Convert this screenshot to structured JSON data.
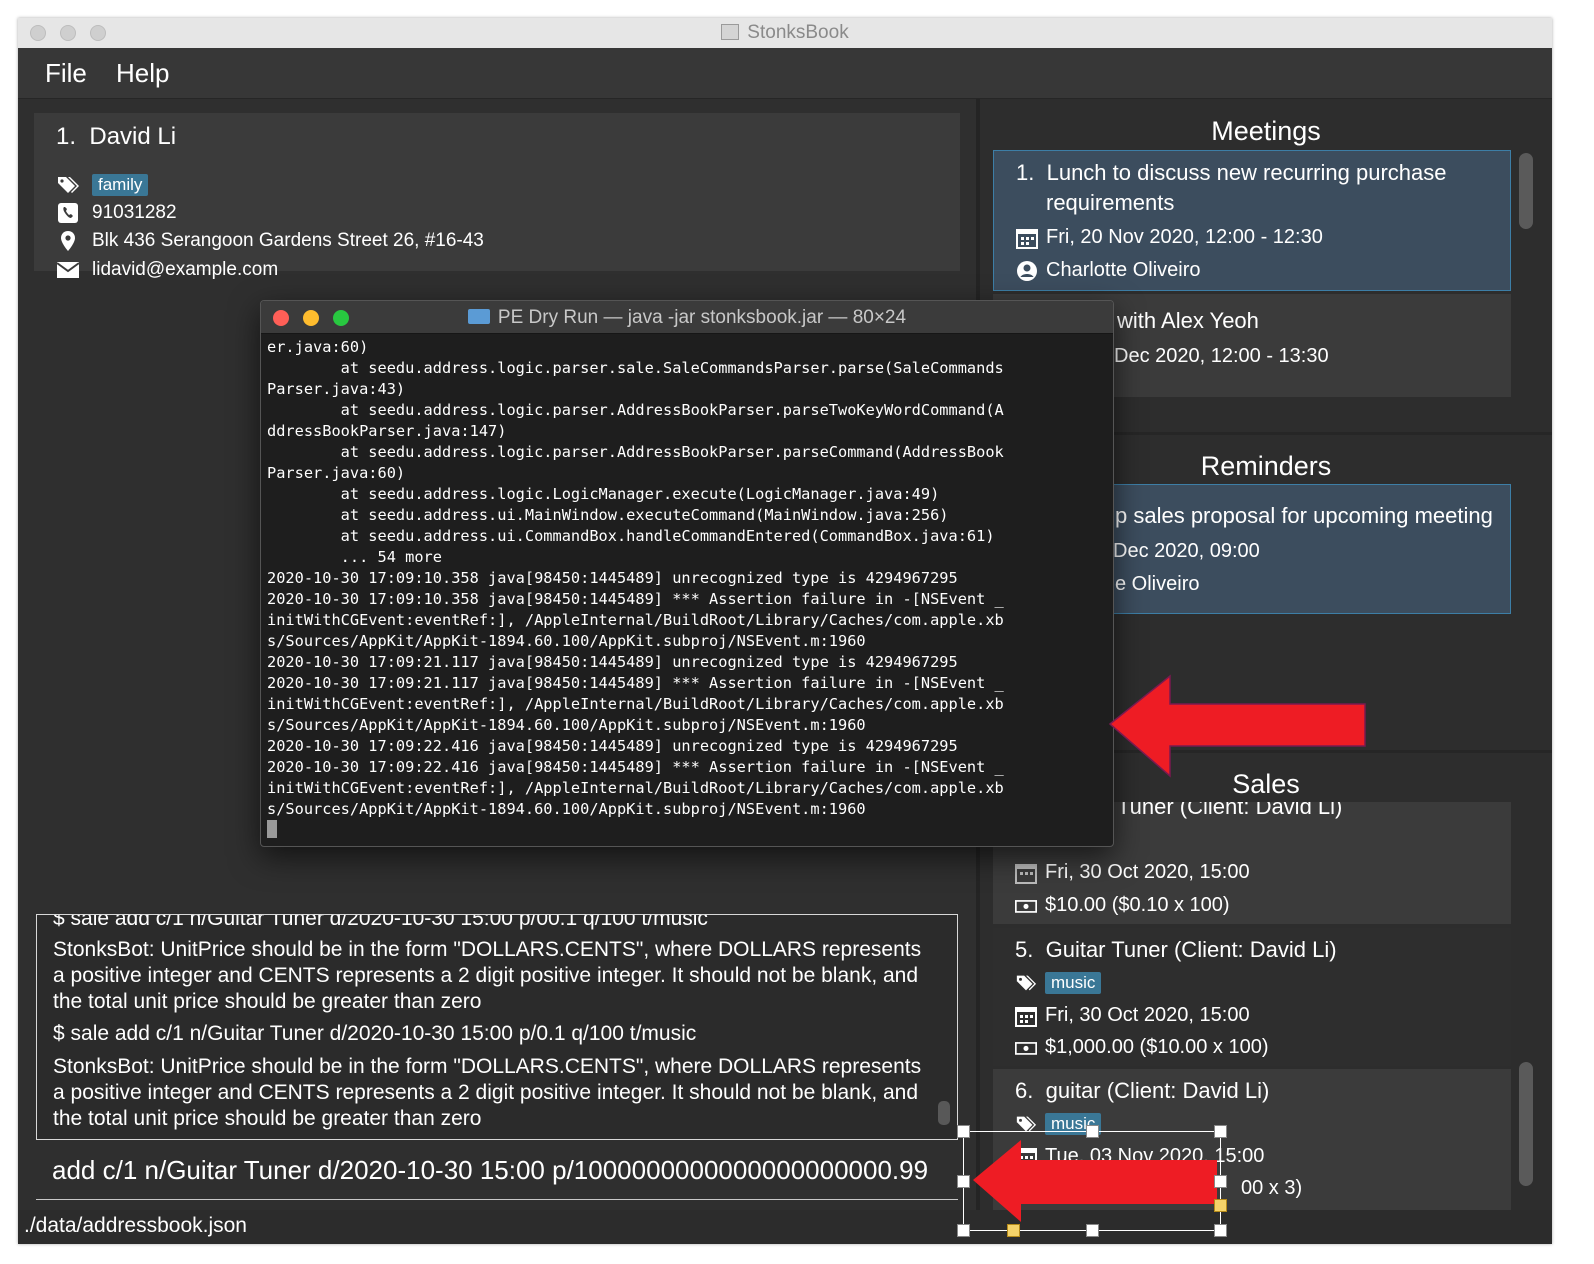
{
  "window": {
    "title": "StonksBook"
  },
  "menu": {
    "file": "File",
    "help": "Help"
  },
  "person": {
    "index": "1.",
    "name": "David Li",
    "tag": "family",
    "phone": "91031282",
    "address": "Blk 436 Serangoon Gardens Street 26, #16-43",
    "email": "lidavid@example.com"
  },
  "result": {
    "clipped_top": "$ sale add c/1 n/Guitar Tuner d/2020-10-30 15:00 p/00.1 q/100 t/music",
    "msg1": "StonksBot: UnitPrice should be in the form \"DOLLARS.CENTS\", where DOLLARS represents a positive integer and CENTS represents a 2 digit positive integer. It should not be blank, and the total unit price should be greater than zero",
    "cmd2": "$ sale add c/1 n/Guitar Tuner d/2020-10-30 15:00 p/0.1 q/100 t/music",
    "msg2": "StonksBot: UnitPrice should be in the form \"DOLLARS.CENTS\", where DOLLARS represents a positive integer and CENTS represents a 2 digit positive integer. It should not be blank, and the total unit price should be greater than zero"
  },
  "command_input": {
    "value": "add c/1 n/Guitar Tuner d/2020-10-30 15:00 p/1000000000000000000000.99"
  },
  "status": {
    "path": "./data/addressbook.json"
  },
  "meetings": {
    "heading": "Meetings",
    "items": [
      {
        "index": "1.",
        "line1": "Lunch to discuss new recurring purchase",
        "line2": "requirements",
        "date": "Fri, 20 Nov 2020, 12:00 - 12:30",
        "contact": "Charlotte Oliveiro"
      },
      {
        "title_partial": "with Alex Yeoh",
        "date_partial": "Dec 2020, 12:00 - 13:30"
      }
    ]
  },
  "reminders": {
    "heading": "Reminders",
    "items": [
      {
        "title_partial": "p sales proposal for upcoming meeting",
        "date_partial": "Dec 2020, 09:00",
        "contact_partial": "e Oliveiro"
      }
    ]
  },
  "sales": {
    "heading": "Sales",
    "items": [
      {
        "title_partial": "Tuner (Client: David Li)",
        "date": "Fri, 30 Oct 2020, 15:00",
        "amount": "$10.00 ($0.10 x 100)"
      },
      {
        "index": "5.",
        "title": "Guitar Tuner (Client: David Li)",
        "tag": "music",
        "date": "Fri, 30 Oct 2020, 15:00",
        "amount": "$1,000.00 ($10.00 x 100)"
      },
      {
        "index": "6.",
        "title": "guitar (Client: David Li)",
        "tag": "music",
        "date": "Tue, 03 Nov 2020, 15:00",
        "amount_partial": "00 x 3)"
      }
    ]
  },
  "terminal": {
    "title": "PE Dry Run — java -jar stonksbook.jar — 80×24",
    "lines": [
      "er.java:60)",
      "        at seedu.address.logic.parser.sale.SaleCommandsParser.parse(SaleCommands",
      "Parser.java:43)",
      "        at seedu.address.logic.parser.AddressBookParser.parseTwoKeyWordCommand(A",
      "ddressBookParser.java:147)",
      "        at seedu.address.logic.parser.AddressBookParser.parseCommand(AddressBook",
      "Parser.java:60)",
      "        at seedu.address.logic.LogicManager.execute(LogicManager.java:49)",
      "        at seedu.address.ui.MainWindow.executeCommand(MainWindow.java:256)",
      "        at seedu.address.ui.CommandBox.handleCommandEntered(CommandBox.java:61)",
      "        ... 54 more",
      "2020-10-30 17:09:10.358 java[98450:1445489] unrecognized type is 4294967295",
      "2020-10-30 17:09:10.358 java[98450:1445489] *** Assertion failure in -[NSEvent _",
      "initWithCGEvent:eventRef:], /AppleInternal/BuildRoot/Library/Caches/com.apple.xb",
      "s/Sources/AppKit/AppKit-1894.60.100/AppKit.subproj/NSEvent.m:1960",
      "2020-10-30 17:09:21.117 java[98450:1445489] unrecognized type is 4294967295",
      "2020-10-30 17:09:21.117 java[98450:1445489] *** Assertion failure in -[NSEvent _",
      "initWithCGEvent:eventRef:], /AppleInternal/BuildRoot/Library/Caches/com.apple.xb",
      "s/Sources/AppKit/AppKit-1894.60.100/AppKit.subproj/NSEvent.m:1960",
      "2020-10-30 17:09:22.416 java[98450:1445489] unrecognized type is 4294967295",
      "2020-10-30 17:09:22.416 java[98450:1445489] *** Assertion failure in -[NSEvent _",
      "initWithCGEvent:eventRef:], /AppleInternal/BuildRoot/Library/Caches/com.apple.xb",
      "s/Sources/AppKit/AppKit-1894.60.100/AppKit.subproj/NSEvent.m:1960"
    ]
  },
  "colors": {
    "arrow": "#ee1c24",
    "tag": "#3a7796",
    "selected_card": "#3c4d5e",
    "selected_border": "#3d7ea6",
    "traffic_red": "#ff5f57",
    "traffic_yellow": "#febc2e",
    "traffic_green": "#28c840"
  },
  "icons": [
    "tag-icon",
    "phone-icon",
    "location-icon",
    "email-icon",
    "calendar-icon",
    "person-icon",
    "money-icon",
    "folder-icon",
    "arrow-annotation"
  ]
}
